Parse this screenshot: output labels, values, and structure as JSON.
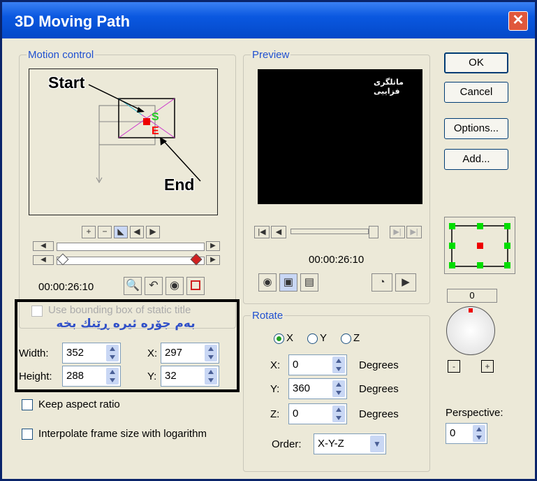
{
  "window": {
    "title": "3D Moving Path"
  },
  "motion": {
    "group_label": "Motion control",
    "start_label": "Start",
    "end_label": "End",
    "s_marker": "S",
    "e_marker": "E",
    "timecode": "00:00:26:10",
    "use_bbox_label": "Use bounding box of static title",
    "arabic_note": "بەم جۆرە ئیرە ڕێنك بخە"
  },
  "size": {
    "width_label": "Width:",
    "width_value": "352",
    "height_label": "Height:",
    "height_value": "288",
    "x_label": "X:",
    "x_value": "297",
    "y_label": "Y:",
    "y_value": "32"
  },
  "options": {
    "keep_aspect": "Keep aspect ratio",
    "interpolate": "Interpolate frame size with logarithm"
  },
  "preview": {
    "group_label": "Preview",
    "overlay_text": "ماتلگری فزاییی",
    "timecode": "00:00:26:10"
  },
  "rotate": {
    "group_label": "Rotate",
    "radio_x": "X",
    "radio_y": "Y",
    "radio_z": "Z",
    "x_label": "X:",
    "x_value": "0",
    "y_label": "Y:",
    "y_value": "360",
    "z_label": "Z:",
    "z_value": "0",
    "unit": "Degrees",
    "order_label": "Order:",
    "order_value": "X-Y-Z"
  },
  "buttons": {
    "ok": "OK",
    "cancel": "Cancel",
    "options": "Options...",
    "add": "Add..."
  },
  "right": {
    "angle_value": "0",
    "minus": "-",
    "plus": "+",
    "perspective_label": "Perspective:",
    "perspective_value": "0"
  },
  "colors": {
    "title_bar": "#0a58e0",
    "start_marker": "#22cc22",
    "end_marker": "#ff0000",
    "handle": "#00dd00",
    "highlight_border": "#000000"
  }
}
